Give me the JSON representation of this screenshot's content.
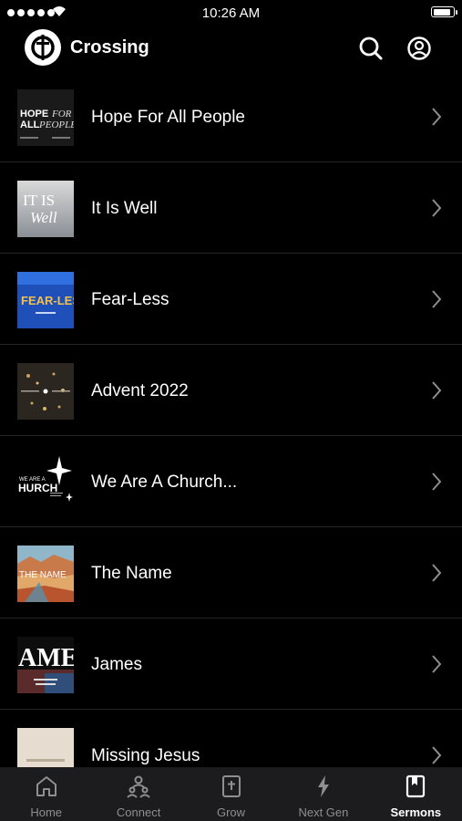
{
  "status_bar": {
    "time": "10:26 AM"
  },
  "header": {
    "title": "Crossing"
  },
  "sermons": [
    {
      "title": "Hope For All People",
      "thumb_text": [
        "HOPE",
        "FOR",
        "ALL",
        "PEOPLE"
      ]
    },
    {
      "title": "It Is Well",
      "thumb_text": [
        "IT IS",
        "Well"
      ]
    },
    {
      "title": "Fear-Less",
      "thumb_text": [
        "FEAR-LESS"
      ]
    },
    {
      "title": "Advent 2022"
    },
    {
      "title": "We Are A Church...",
      "thumb_text": [
        "WE ARE A",
        "HURCH"
      ]
    },
    {
      "title": "The Name",
      "thumb_text": [
        "THE NAME"
      ]
    },
    {
      "title": "James",
      "thumb_text": [
        "AME"
      ]
    },
    {
      "title": "Missing Jesus"
    }
  ],
  "tabs": [
    {
      "label": "Home",
      "icon": "home-icon"
    },
    {
      "label": "Connect",
      "icon": "connect-icon"
    },
    {
      "label": "Grow",
      "icon": "bible-icon"
    },
    {
      "label": "Next Gen",
      "icon": "lightning-icon"
    },
    {
      "label": "Sermons",
      "icon": "book-icon",
      "active": true
    }
  ]
}
